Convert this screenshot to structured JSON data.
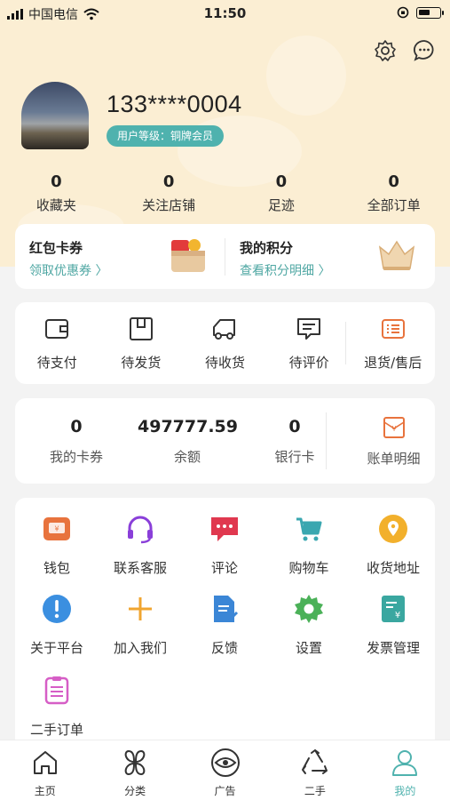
{
  "status_bar": {
    "carrier": "中国电信",
    "time": "11:50"
  },
  "profile": {
    "phone": "133****0004",
    "level": "用户等级：铜牌会员"
  },
  "stats": [
    {
      "value": "0",
      "label": "收藏夹"
    },
    {
      "value": "0",
      "label": "关注店铺"
    },
    {
      "value": "0",
      "label": "足迹"
    },
    {
      "value": "0",
      "label": "全部订单"
    }
  ],
  "promo": {
    "coupon": {
      "title": "红包卡券",
      "link": "领取优惠券 〉"
    },
    "points": {
      "title": "我的积分",
      "link": "查看积分明细 〉"
    }
  },
  "orders": [
    {
      "label": "待支付",
      "icon": "wallet-icon"
    },
    {
      "label": "待发货",
      "icon": "package-icon"
    },
    {
      "label": "待收货",
      "icon": "truck-icon"
    },
    {
      "label": "待评价",
      "icon": "comment-icon"
    },
    {
      "label": "退货/售后",
      "icon": "return-icon"
    }
  ],
  "wallet": {
    "cards": {
      "value": "0",
      "label": "我的卡券"
    },
    "balance": {
      "value": "497777.59",
      "label": "余额"
    },
    "bank": {
      "value": "0",
      "label": "银行卡"
    },
    "bill": {
      "label": "账单明细",
      "icon": "bill-icon"
    }
  },
  "services": [
    {
      "label": "钱包",
      "icon": "purse-icon"
    },
    {
      "label": "联系客服",
      "icon": "headset-icon"
    },
    {
      "label": "评论",
      "icon": "chat-icon"
    },
    {
      "label": "购物车",
      "icon": "cart-icon"
    },
    {
      "label": "收货地址",
      "icon": "location-icon"
    },
    {
      "label": "关于平台",
      "icon": "info-icon"
    },
    {
      "label": "加入我们",
      "icon": "plus-icon"
    },
    {
      "label": "反馈",
      "icon": "feedback-icon"
    },
    {
      "label": "设置",
      "icon": "gear-icon"
    },
    {
      "label": "发票管理",
      "icon": "invoice-icon"
    },
    {
      "label": "二手订单",
      "icon": "secondhand-order-icon"
    }
  ],
  "tabbar": [
    {
      "label": "主页",
      "icon": "home-icon"
    },
    {
      "label": "分类",
      "icon": "category-icon"
    },
    {
      "label": "广告",
      "icon": "ad-eye-icon"
    },
    {
      "label": "二手",
      "icon": "recycle-icon"
    },
    {
      "label": "我的",
      "icon": "profile-icon",
      "active": true
    }
  ],
  "colors": {
    "accent": "#4fb2ae",
    "header_bg": "#fbeed3",
    "page_bg": "#f3f3f3"
  }
}
